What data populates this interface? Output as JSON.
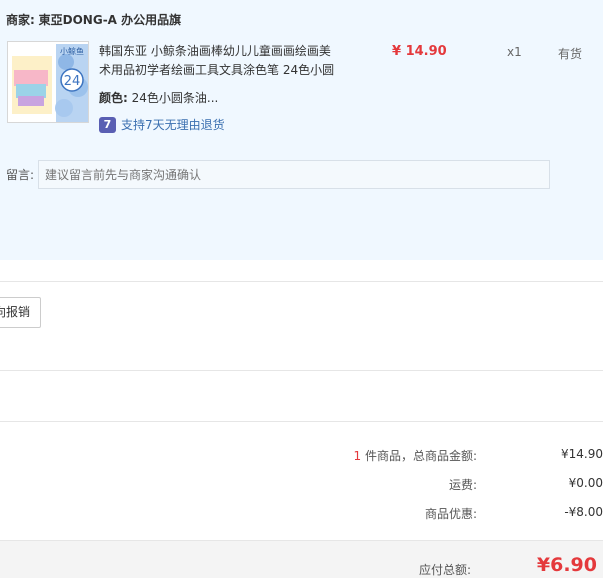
{
  "merchant": {
    "label": "商家:",
    "name": "東亞DONG-A 办公用品旗"
  },
  "item": {
    "title": "韩国东亚 小鲸条油画棒幼儿儿童画画绘画美术用品初学者绘画工具文具涂色笔 24色小圆",
    "color_label": "颜色:",
    "color_value": "24色小圆条油...",
    "return_badge": "7",
    "return_text": "支持7天无理由退货",
    "price": "¥ 14.90",
    "qty": "x1",
    "stock": "有货",
    "thumb_text": "小鲸鱼",
    "thumb_number": "24"
  },
  "note": {
    "label": "留言:",
    "placeholder": "建议留言前先与商家沟通确认"
  },
  "invoice_button": "向报销",
  "summary": {
    "count": "1",
    "count_suffix": " 件商品，总商品金额:",
    "goods_total": "¥14.90",
    "shipping_label": "运费:",
    "shipping": "¥0.00",
    "discount_label": "商品优惠:",
    "discount": "-¥8.00",
    "payable_label": "应付总额:",
    "payable": "¥6.90"
  },
  "colors": {
    "accent": "#e4393c",
    "panel_bg": "#f0f8ff",
    "badge": "#5a5fb3"
  }
}
